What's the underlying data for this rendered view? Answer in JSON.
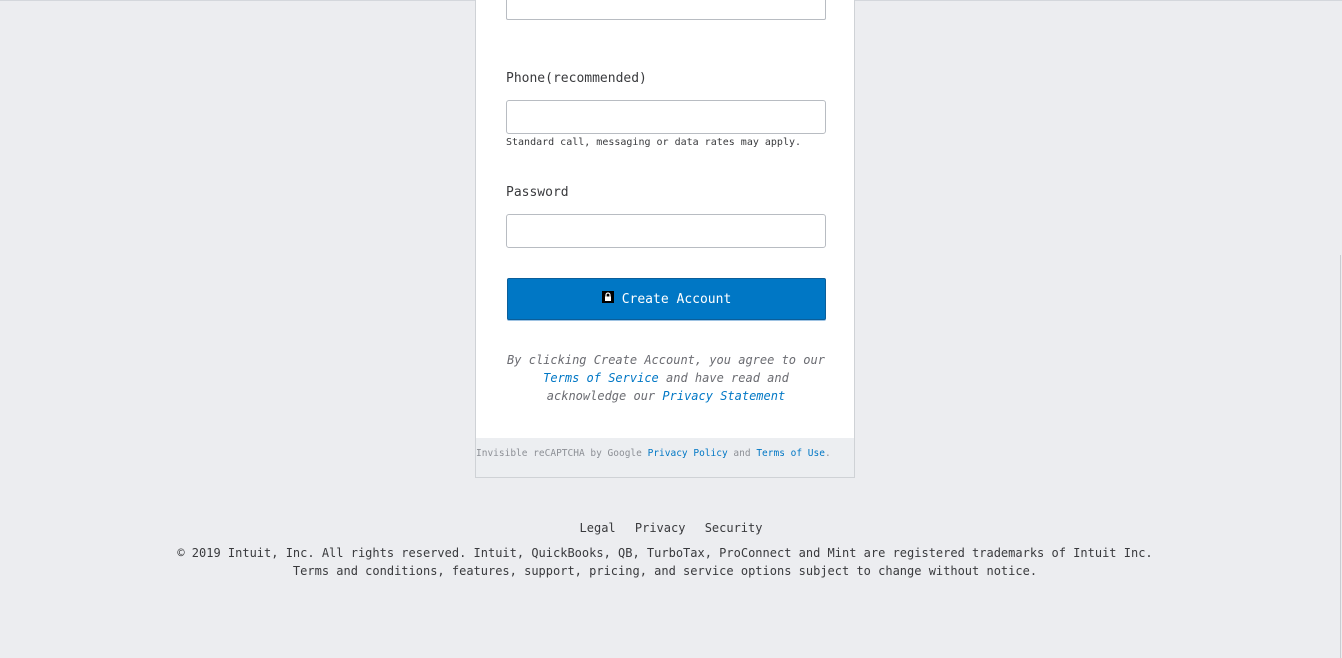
{
  "form": {
    "phone_label": "Phone(recommended)",
    "phone_value": "",
    "phone_helper": "Standard call, messaging or data rates may apply.",
    "password_label": "Password",
    "password_value": "",
    "create_button_label": "Create Account",
    "agreement_prefix": "By clicking Create Account, you agree to our",
    "terms_link": "Terms of Service",
    "agreement_middle": "and have read and acknowledge our",
    "privacy_link": "Privacy Statement"
  },
  "recaptcha": {
    "prefix": "Invisible reCAPTCHA by Google",
    "privacy_policy_link": "Privacy Policy",
    "and_text": "and",
    "terms_of_use_link": "Terms of Use",
    "suffix": "."
  },
  "footer": {
    "links": [
      "Legal",
      "Privacy",
      "Security"
    ],
    "copyright_line1": "© 2019 Intuit, Inc. All rights reserved. Intuit, QuickBooks, QB, TurboTax, ProConnect and Mint are registered trademarks of Intuit Inc.",
    "copyright_line2": "Terms and conditions, features, support, pricing, and service options subject to change without notice."
  },
  "icons": {
    "button_icon": "lock-icon"
  },
  "colors": {
    "primary": "#0077c5",
    "background": "#ecedf0",
    "text": "#393a3d"
  }
}
